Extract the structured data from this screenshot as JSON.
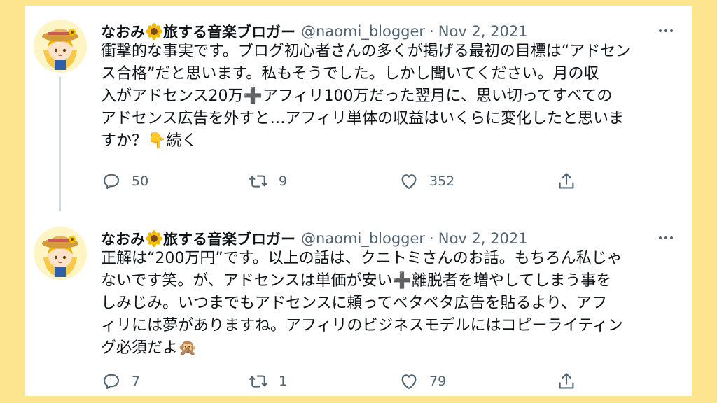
{
  "tweets": [
    {
      "author_name_pre": "なおみ",
      "author_name_post": "旅する音楽ブロガー",
      "handle": "@naomi_blogger",
      "separator": "·",
      "date": "Nov 2, 2021",
      "lines": [
        "衝撃的な事実です。ブログ初心者さんの多くが掲げる最初の目標は“アドセン",
        "ス合格”だと思います。私もそうでした。しかし聞いてください。月の収",
        "入がアドセンス20万➕アフィリ100万だった翌月に、思い切ってすべての",
        "アドセンス広告を外すと…アフィリ単体の収益はいくらに変化したと思いま",
        "すか？👇続く"
      ],
      "replies": "50",
      "retweets": "9",
      "likes": "352"
    },
    {
      "author_name_pre": "なおみ",
      "author_name_post": "旅する音楽ブロガー",
      "handle": "@naomi_blogger",
      "separator": "·",
      "date": "Nov 2, 2021",
      "lines": [
        "正解は“200万円”です。以上の話は、クニトミさんのお話。もちろん私じゃ",
        "ないです笑。が、アドセンスは単価が安い➕離脱者を増やしてしまう事を",
        "しみじみ。いつまでもアドセンスに頼ってペタペタ広告を貼るより、アフ",
        "ィリには夢がありますね。アフィリのビジネスモデルにはコピーライティン",
        "グ必須だよ🙊"
      ],
      "replies": "7",
      "retweets": "1",
      "likes": "79"
    }
  ],
  "icons": {
    "reply": "reply-icon",
    "retweet": "retweet-icon",
    "like": "heart-icon",
    "share": "share-icon",
    "more": "more-icon"
  },
  "colors": {
    "background": "#fde58f",
    "card": "#ffffff",
    "text": "#0f1419",
    "secondary": "#536471",
    "thread_line": "#cfd9de"
  }
}
